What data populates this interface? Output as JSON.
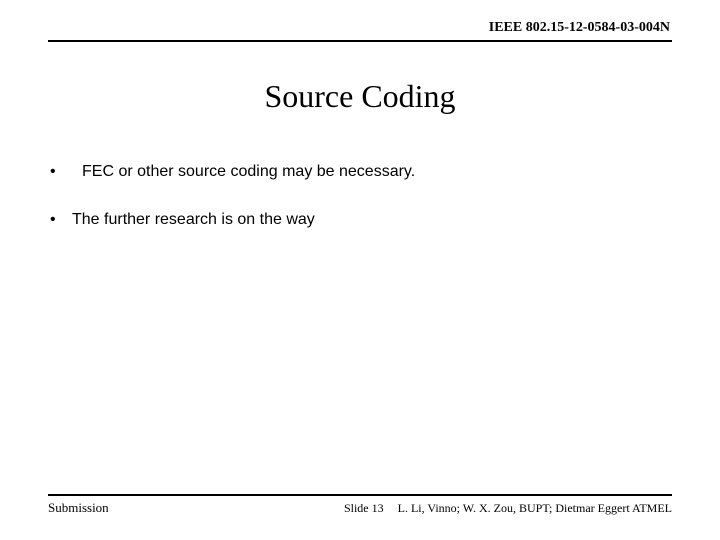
{
  "header": {
    "doc_number": "IEEE 802.15-12-0584-03-004N"
  },
  "title": "Source Coding",
  "bullets": [
    {
      "text": "FEC or other source coding may be necessary."
    },
    {
      "text": "The further research is on the way"
    }
  ],
  "footer": {
    "left": "Submission",
    "slide": "Slide 13",
    "authors": "L. Li, Vinno; W. X. Zou, BUPT; Dietmar Eggert ATMEL"
  }
}
